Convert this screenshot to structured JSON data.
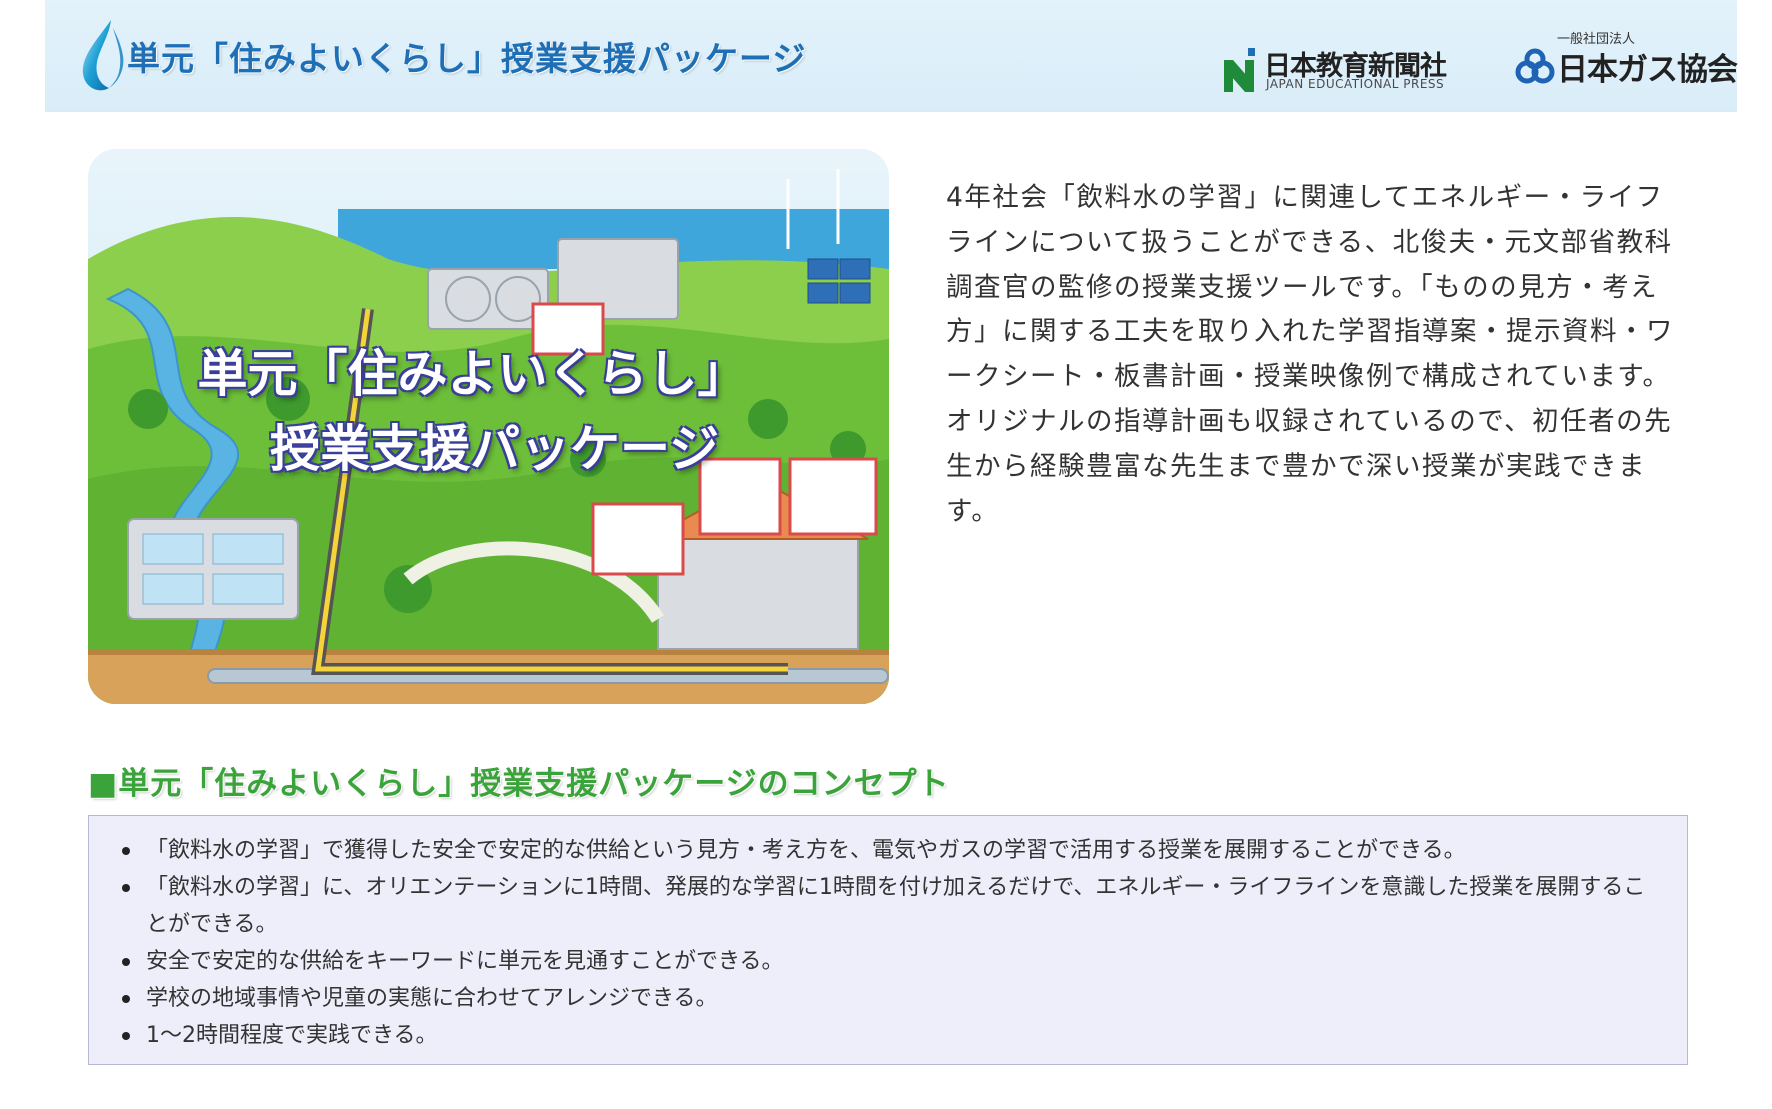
{
  "header": {
    "title": "単元「住みよいくらし」授業支援パッケージ",
    "publisher_logo": {
      "name": "日本教育新聞社",
      "english": "JAPAN EDUCATIONAL PRESS"
    },
    "association_logo": {
      "prefix": "一般社団法人",
      "name": "日本ガス協会"
    }
  },
  "hero": {
    "caption_line1": "単元「住みよいくらし」",
    "caption_line2": "授業支援パッケージ"
  },
  "intro": {
    "text": "4年社会「飲料水の学習」に関連してエネルギー・ライフラインについて扱うことができる、北俊夫・元文部省教科調査官の監修の授業支援ツールです。「ものの見方・考え方」に関する工夫を取り入れた学習指導案・提示資料・ワークシート・板書計画・授業映像例で構成されています。オリジナルの指導計画も収録されているので、初任者の先生から経験豊富な先生まで豊かで深い授業が実践できます。"
  },
  "concept": {
    "heading": "■単元「住みよいくらし」授業支援パッケージのコンセプト",
    "items": [
      "「飲料水の学習」で獲得した安全で安定的な供給という見方・考え方を、電気やガスの学習で活用する授業を展開することができる。",
      "「飲料水の学習」に、オリエンテーションに1時間、発展的な学習に1時間を付け加えるだけで、エネルギー・ライフラインを意識した授業を展開することができる。",
      "安全で安定的な供給をキーワードに単元を見通すことができる。",
      "学校の地域事情や児童の実態に合わせてアレンジできる。",
      "1〜2時間程度で実践できる。"
    ]
  },
  "colors": {
    "header_bg": "#dceef9",
    "title_blue": "#1e6fb5",
    "heading_green": "#3aa43a",
    "box_bg": "#eeeefb",
    "box_border": "#b8b8d4"
  },
  "icons": {
    "header": "water-drop-icon",
    "publisher": "jep-n-mark-icon",
    "association": "gas-association-mark-icon"
  }
}
